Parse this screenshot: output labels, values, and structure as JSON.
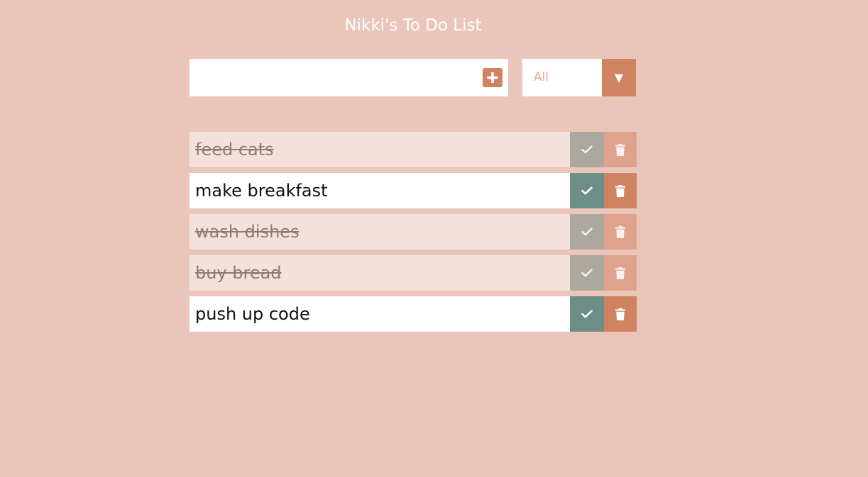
{
  "header": {
    "title": "Nikki's To Do List"
  },
  "form": {
    "input_value": "",
    "input_placeholder": "",
    "add_icon": "plus-icon",
    "filter_selected": "All",
    "filter_arrow": "▼"
  },
  "todos": [
    {
      "text": "feed cats",
      "completed": true
    },
    {
      "text": "make breakfast",
      "completed": false
    },
    {
      "text": "wash dishes",
      "completed": true
    },
    {
      "text": "buy bread",
      "completed": true
    },
    {
      "text": "push up code",
      "completed": false
    }
  ],
  "colors": {
    "background": "#e9c6b9",
    "accent": "#cf8361",
    "check": "#6e8e88",
    "filter_text": "#f3a48f",
    "completed_row": "#f4e1dc"
  }
}
